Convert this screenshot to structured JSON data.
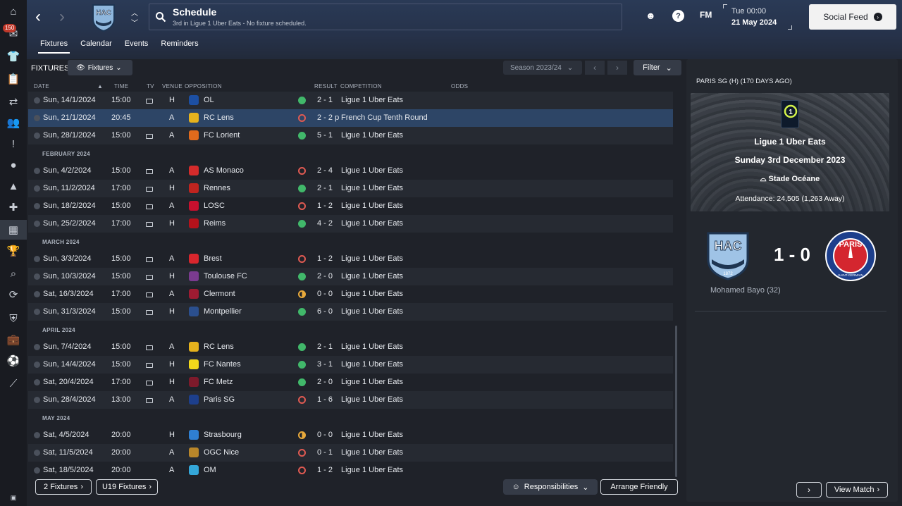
{
  "sidebar": {
    "inbox_badge": "150"
  },
  "header": {
    "title": "Schedule",
    "subtitle": "3rd in Ligue 1 Uber Eats - No fixture scheduled.",
    "fm_label": "FM",
    "help_label": "?",
    "day_time": "Tue 00:00",
    "date": "21 May 2024",
    "social_feed": "Social Feed"
  },
  "tabs": [
    "Fixtures",
    "Calendar",
    "Events",
    "Reminders"
  ],
  "toolbar": {
    "fixtures_label": "FIXTURES",
    "fixtures_dropdown": "Fixtures",
    "season": "Season 2023/24",
    "filter": "Filter"
  },
  "columns": {
    "date": "DATE",
    "time": "TIME",
    "tv": "TV",
    "venue": "VENUE",
    "opposition": "OPPOSITION",
    "result": "RESULT",
    "competition": "COMPETITION",
    "odds": "ODDS"
  },
  "rows": [
    {
      "type": "match",
      "date": "Sun, 14/1/2024",
      "time": "15:00",
      "tv": true,
      "venue": "H",
      "opp": "OL",
      "res": "W",
      "score": "2 - 1",
      "comp": "Ligue 1 Uber Eats",
      "color": "#1c4fa3"
    },
    {
      "type": "match",
      "date": "Sun, 21/1/2024",
      "time": "20:45",
      "tv": false,
      "venue": "A",
      "opp": "RC Lens",
      "res": "L",
      "score": "2 - 2 p",
      "comp": "French Cup Tenth Round",
      "color": "#e5b21d",
      "selected": true
    },
    {
      "type": "match",
      "date": "Sun, 28/1/2024",
      "time": "15:00",
      "tv": true,
      "venue": "A",
      "opp": "FC Lorient",
      "res": "W",
      "score": "5 - 1",
      "comp": "Ligue 1 Uber Eats",
      "color": "#e06a1c"
    },
    {
      "type": "month",
      "label": "FEBRUARY 2024"
    },
    {
      "type": "match",
      "date": "Sun, 4/2/2024",
      "time": "15:00",
      "tv": true,
      "venue": "A",
      "opp": "AS Monaco",
      "res": "L",
      "score": "2 - 4",
      "comp": "Ligue 1 Uber Eats",
      "color": "#d42b2b"
    },
    {
      "type": "match",
      "date": "Sun, 11/2/2024",
      "time": "17:00",
      "tv": true,
      "venue": "H",
      "opp": "Rennes",
      "res": "W",
      "score": "2 - 1",
      "comp": "Ligue 1 Uber Eats",
      "color": "#c0241f"
    },
    {
      "type": "match",
      "date": "Sun, 18/2/2024",
      "time": "15:00",
      "tv": true,
      "venue": "A",
      "opp": "LOSC",
      "res": "L",
      "score": "1 - 2",
      "comp": "Ligue 1 Uber Eats",
      "color": "#c8102e"
    },
    {
      "type": "match",
      "date": "Sun, 25/2/2024",
      "time": "17:00",
      "tv": true,
      "venue": "H",
      "opp": "Reims",
      "res": "W",
      "score": "4 - 2",
      "comp": "Ligue 1 Uber Eats",
      "color": "#b5121b"
    },
    {
      "type": "month",
      "label": "MARCH 2024"
    },
    {
      "type": "match",
      "date": "Sun, 3/3/2024",
      "time": "15:00",
      "tv": true,
      "venue": "A",
      "opp": "Brest",
      "res": "L",
      "score": "1 - 2",
      "comp": "Ligue 1 Uber Eats",
      "color": "#d8262d"
    },
    {
      "type": "match",
      "date": "Sun, 10/3/2024",
      "time": "15:00",
      "tv": true,
      "venue": "H",
      "opp": "Toulouse FC",
      "res": "W",
      "score": "2 - 0",
      "comp": "Ligue 1 Uber Eats",
      "color": "#7a3b8f"
    },
    {
      "type": "match",
      "date": "Sat, 16/3/2024",
      "time": "17:00",
      "tv": true,
      "venue": "A",
      "opp": "Clermont",
      "res": "D",
      "score": "0 - 0",
      "comp": "Ligue 1 Uber Eats",
      "color": "#9e1b32"
    },
    {
      "type": "match",
      "date": "Sun, 31/3/2024",
      "time": "15:00",
      "tv": true,
      "venue": "H",
      "opp": "Montpellier",
      "res": "W",
      "score": "6 - 0",
      "comp": "Ligue 1 Uber Eats",
      "color": "#2b4f8e"
    },
    {
      "type": "month",
      "label": "APRIL 2024"
    },
    {
      "type": "match",
      "date": "Sun, 7/4/2024",
      "time": "15:00",
      "tv": true,
      "venue": "A",
      "opp": "RC Lens",
      "res": "W",
      "score": "2 - 1",
      "comp": "Ligue 1 Uber Eats",
      "color": "#e5b21d"
    },
    {
      "type": "match",
      "date": "Sun, 14/4/2024",
      "time": "15:00",
      "tv": true,
      "venue": "H",
      "opp": "FC Nantes",
      "res": "W",
      "score": "3 - 1",
      "comp": "Ligue 1 Uber Eats",
      "color": "#f2d91b"
    },
    {
      "type": "match",
      "date": "Sat, 20/4/2024",
      "time": "17:00",
      "tv": true,
      "venue": "H",
      "opp": "FC Metz",
      "res": "W",
      "score": "2 - 0",
      "comp": "Ligue 1 Uber Eats",
      "color": "#7d1a2b"
    },
    {
      "type": "match",
      "date": "Sun, 28/4/2024",
      "time": "13:00",
      "tv": true,
      "venue": "A",
      "opp": "Paris SG",
      "res": "L",
      "score": "1 - 6",
      "comp": "Ligue 1 Uber Eats",
      "color": "#1d3f8c"
    },
    {
      "type": "month",
      "label": "MAY 2024"
    },
    {
      "type": "match",
      "date": "Sat, 4/5/2024",
      "time": "20:00",
      "tv": false,
      "venue": "H",
      "opp": "Strasbourg",
      "res": "D",
      "score": "0 - 0",
      "comp": "Ligue 1 Uber Eats",
      "color": "#2f7fd1"
    },
    {
      "type": "match",
      "date": "Sat, 11/5/2024",
      "time": "20:00",
      "tv": false,
      "venue": "A",
      "opp": "OGC Nice",
      "res": "L",
      "score": "0 - 1",
      "comp": "Ligue 1 Uber Eats",
      "color": "#b8862a"
    },
    {
      "type": "match",
      "date": "Sat, 18/5/2024",
      "time": "20:00",
      "tv": false,
      "venue": "A",
      "opp": "OM",
      "res": "L",
      "score": "1 - 2",
      "comp": "Ligue 1 Uber Eats",
      "color": "#34a7d9"
    }
  ],
  "buttons": {
    "fixtures2": "2 Fixtures",
    "u19": "U19 Fixtures",
    "responsibilities": "Responsibilities",
    "arrange": "Arrange Friendly"
  },
  "side": {
    "header": "PARIS SG (H) (170 DAYS AGO)",
    "competition": "Ligue 1 Uber Eats",
    "date": "Sunday 3rd December 2023",
    "stadium": "Stade Océane",
    "attendance": "Attendance: 24,505 (1,263 Away)",
    "score": "1 - 0",
    "scorer": "Mohamed Bayo (32)",
    "view_match": "View Match",
    "home_crest": "HAC",
    "home_crest_year": "1872",
    "away_crest": "PARIS",
    "away_crest_sub": "SAINT-GERMAIN",
    "league_logo_text": "Ligue 1 Uber Eats"
  }
}
